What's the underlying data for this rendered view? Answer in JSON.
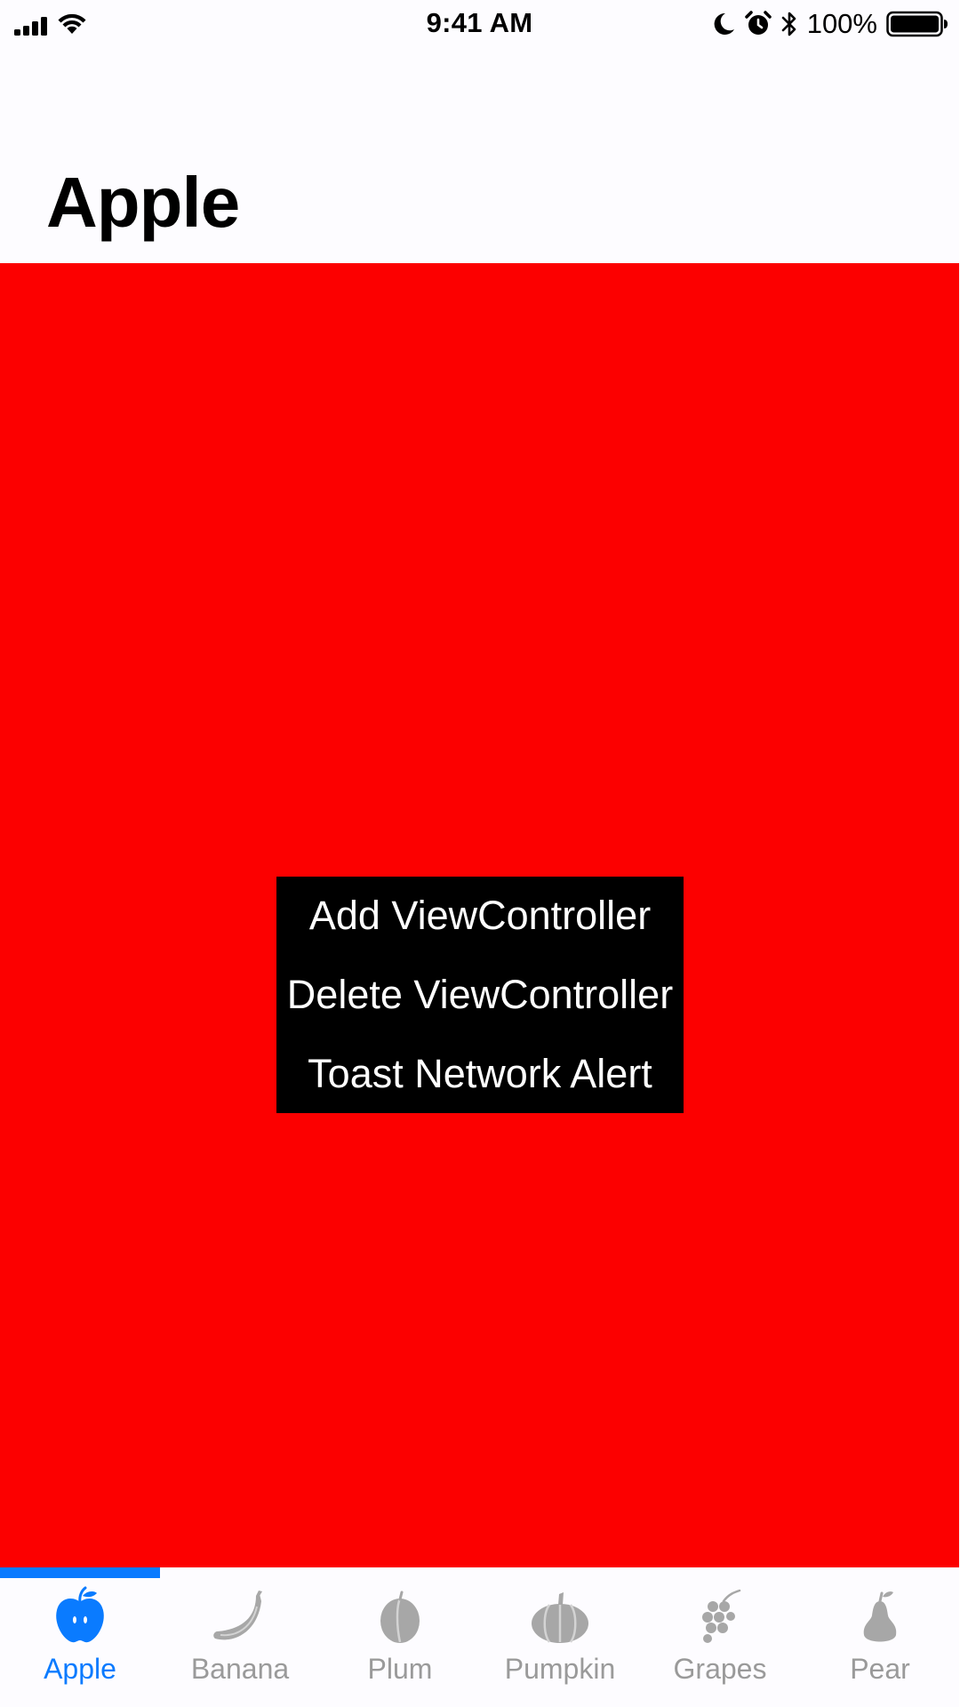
{
  "status_bar": {
    "time": "9:41 AM",
    "battery_percent": "100%",
    "battery_level": 1.0,
    "icons": [
      "signal-icon",
      "wifi-icon",
      "moon-icon",
      "alarm-icon",
      "bluetooth-icon",
      "battery-icon"
    ]
  },
  "nav": {
    "title": "Apple"
  },
  "content": {
    "background_color": "#fc0000",
    "actions": {
      "add": "Add ViewController",
      "delete": "Delete ViewController",
      "toast": "Toast Network Alert"
    }
  },
  "tab_bar": {
    "accent_color": "#0a7bff",
    "inactive_color": "#9a9a9a",
    "selected_index": 0,
    "tabs": [
      {
        "label": "Apple",
        "icon": "apple-icon"
      },
      {
        "label": "Banana",
        "icon": "banana-icon"
      },
      {
        "label": "Plum",
        "icon": "plum-icon"
      },
      {
        "label": "Pumpkin",
        "icon": "pumpkin-icon"
      },
      {
        "label": "Grapes",
        "icon": "grapes-icon"
      },
      {
        "label": "Pear",
        "icon": "pear-icon"
      }
    ]
  }
}
